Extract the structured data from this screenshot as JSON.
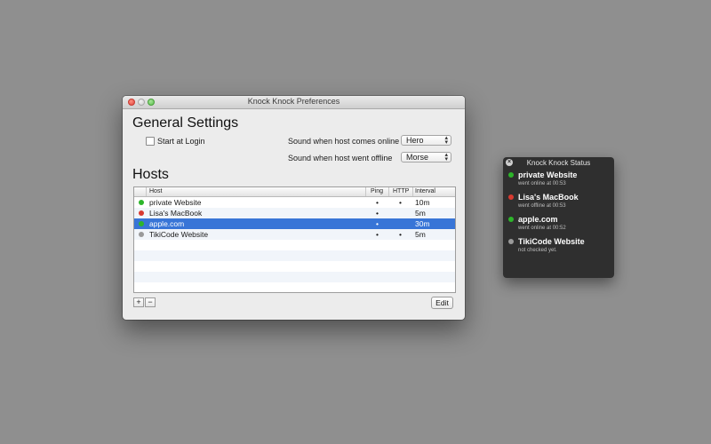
{
  "window": {
    "title": "Knock Knock Preferences"
  },
  "general": {
    "heading": "General Settings",
    "start_at_login_label": "Start at Login",
    "start_at_login_checked": false,
    "sound_online_label": "Sound when host comes online",
    "sound_online_value": "Hero",
    "sound_offline_label": "Sound when host went offline",
    "sound_offline_value": "Morse"
  },
  "hosts": {
    "heading": "Hosts",
    "columns": [
      "Host",
      "Ping",
      "HTTP",
      "Interval"
    ],
    "rows": [
      {
        "name": "private Website",
        "ping": "•",
        "http": "•",
        "interval": "10m",
        "status_color": "#2db52a",
        "selected": false
      },
      {
        "name": "Lisa's MacBook",
        "ping": "•",
        "http": "",
        "interval": "5m",
        "status_color": "#d83a30",
        "selected": false
      },
      {
        "name": "apple.com",
        "ping": "•",
        "http": "",
        "interval": "30m",
        "status_color": "#2db52a",
        "selected": true
      },
      {
        "name": "TikiCode Website",
        "ping": "•",
        "http": "•",
        "interval": "5m",
        "status_color": "#9a9a9a",
        "selected": false
      }
    ],
    "add_label": "+",
    "remove_label": "−",
    "edit_label": "Edit"
  },
  "status_panel": {
    "title": "Knock Knock Status",
    "close_glyph": "×",
    "items": [
      {
        "name": "private Website",
        "status": "went online at 00:53",
        "color": "#2db52a"
      },
      {
        "name": "Lisa's MacBook",
        "status": "went offline at 00:53",
        "color": "#d83a30"
      },
      {
        "name": "apple.com",
        "status": "went online at 00:52",
        "color": "#2db52a"
      },
      {
        "name": "TikiCode Website",
        "status": "not checked yet.",
        "color": "#9a9a9a"
      }
    ]
  },
  "colors": {
    "selection": "#3875d7",
    "online": "#2db52a",
    "offline": "#d83a30",
    "unknown": "#9a9a9a"
  }
}
